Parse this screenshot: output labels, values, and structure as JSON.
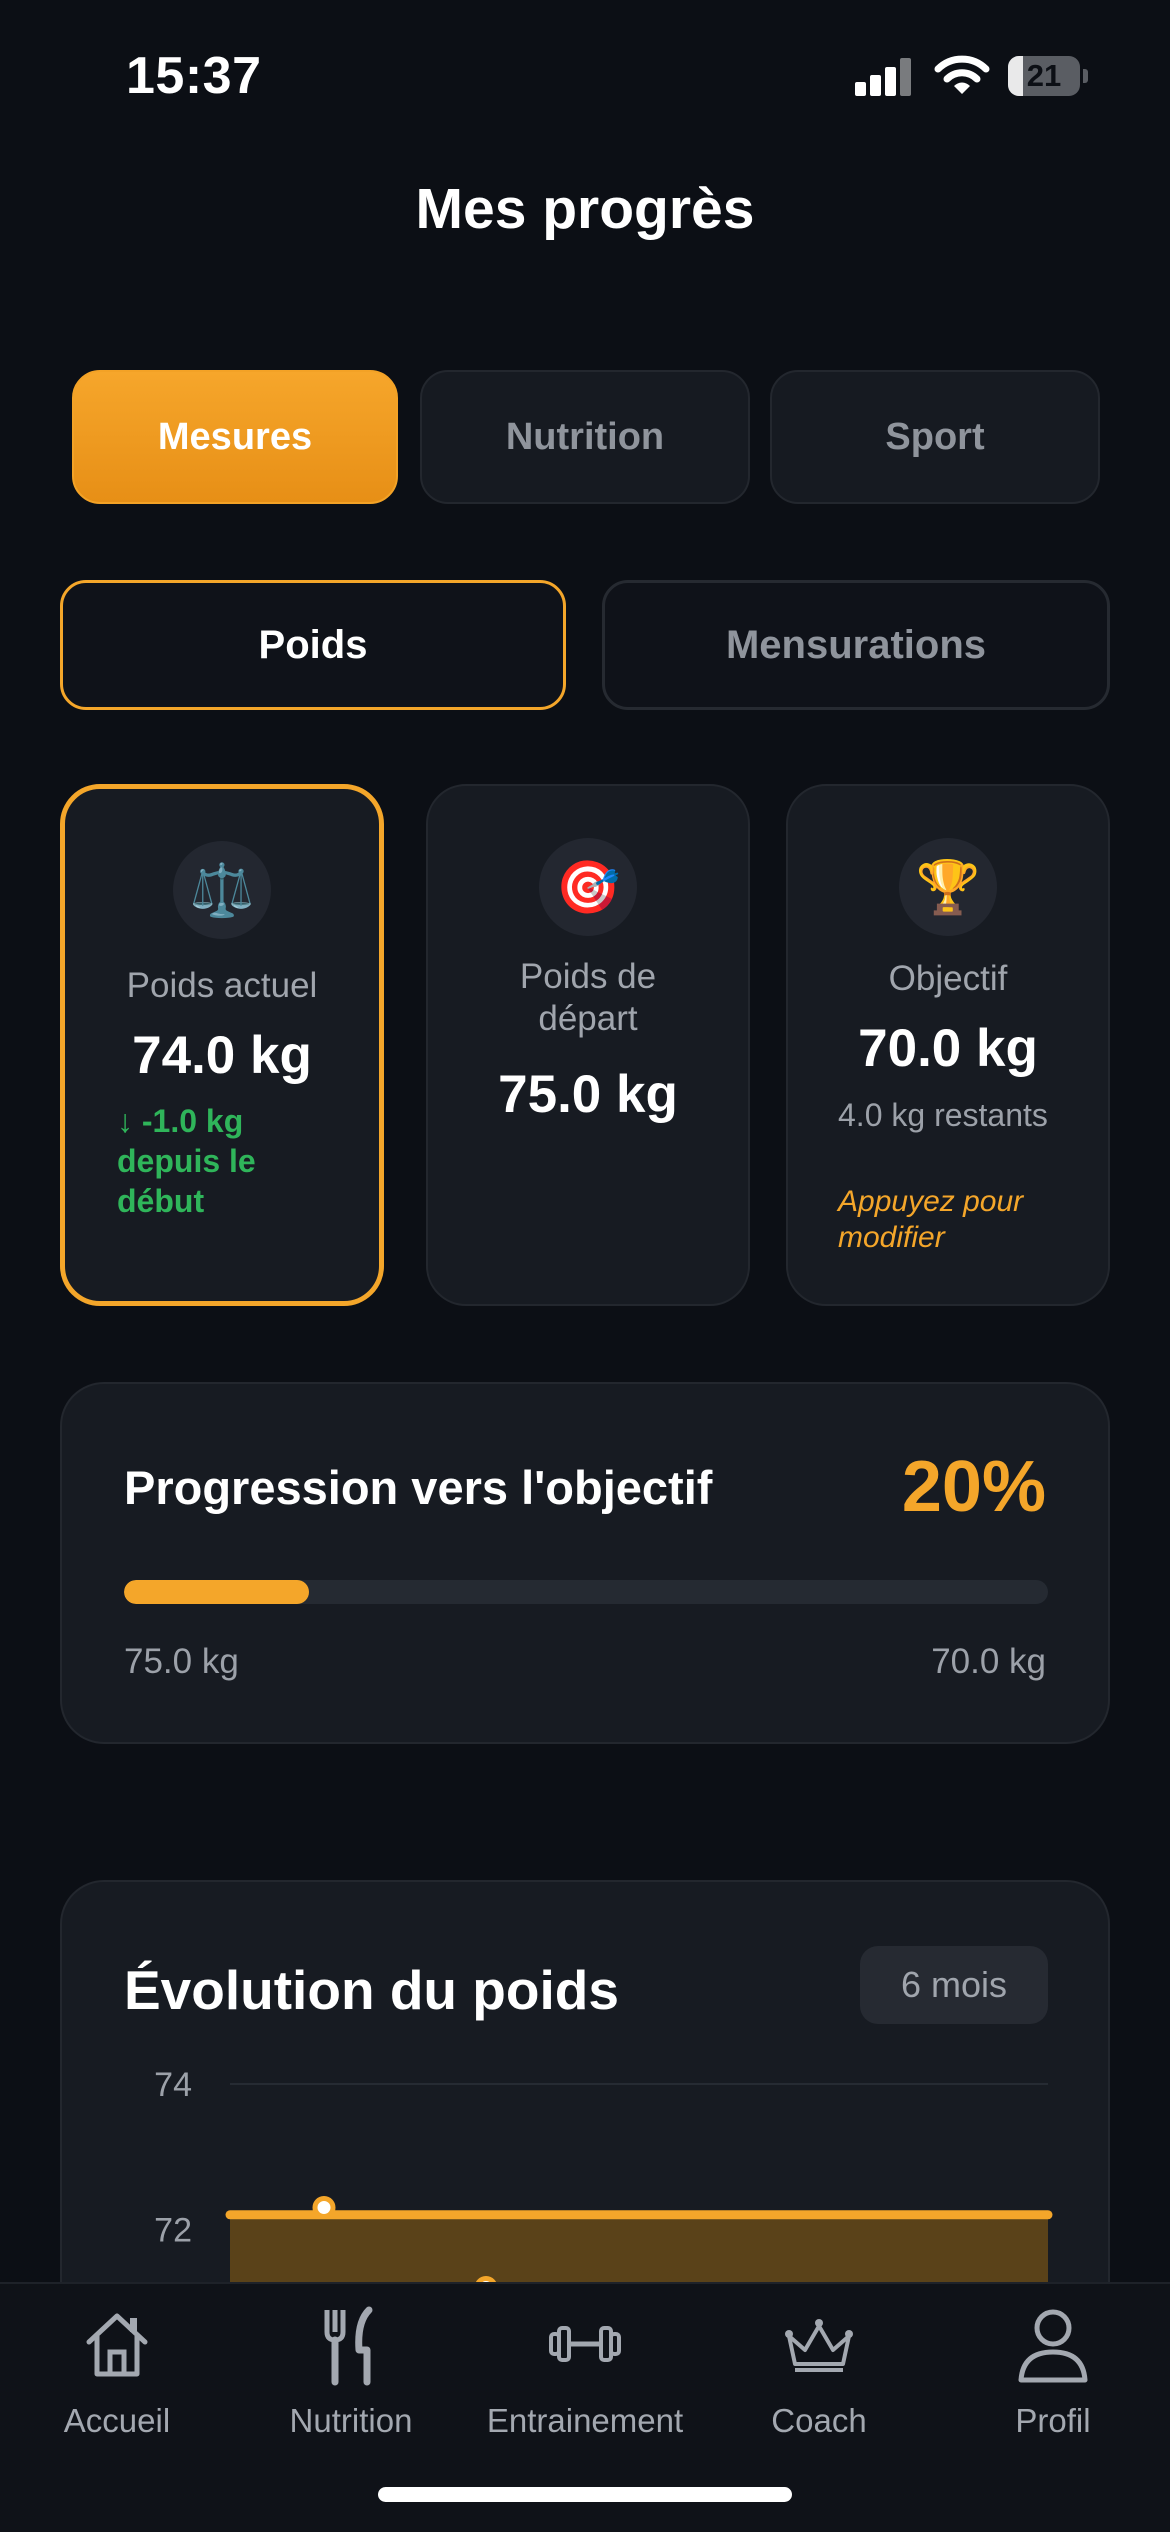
{
  "status": {
    "time": "15:37",
    "battery": "21",
    "battery_level": 0.21
  },
  "header": {
    "title": "Mes progrès"
  },
  "tabs": [
    {
      "label": "Mesures",
      "active": true
    },
    {
      "label": "Nutrition",
      "active": false
    },
    {
      "label": "Sport",
      "active": false
    }
  ],
  "subtabs": [
    {
      "label": "Poids",
      "active": true
    },
    {
      "label": "Mensurations",
      "active": false
    }
  ],
  "cards": {
    "current": {
      "icon": "scale-icon",
      "label": "Poids actuel",
      "value": "74.0 kg",
      "delta": "↓ -1.0 kg depuis le début"
    },
    "start": {
      "icon": "target-icon",
      "label": "Poids de départ",
      "value": "75.0 kg"
    },
    "goal": {
      "icon": "trophy-icon",
      "label": "Objectif",
      "value": "70.0 kg",
      "remaining": "4.0 kg restants",
      "hint": "Appuyez pour modifier"
    }
  },
  "progress": {
    "title": "Progression vers l'objectif",
    "percent_label": "20%",
    "percent": 20,
    "start_label": "75.0 kg",
    "end_label": "70.0 kg"
  },
  "chart": {
    "title": "Évolution du poids",
    "period": "6 mois"
  },
  "chart_data": {
    "type": "area",
    "title": "Évolution du poids",
    "y_ticks": [
      "74",
      "72"
    ],
    "ylim_visible": [
      71,
      74
    ],
    "series": [
      {
        "values": [
          72.2,
          72.2
        ]
      }
    ],
    "points": [
      {
        "y": 72.3
      },
      {
        "y": 71.2
      }
    ]
  },
  "nav": [
    {
      "label": "Accueil",
      "icon": "home-icon"
    },
    {
      "label": "Nutrition",
      "icon": "fork-knife-icon"
    },
    {
      "label": "Entrainement",
      "icon": "dumbbell-icon"
    },
    {
      "label": "Coach",
      "icon": "crown-icon"
    },
    {
      "label": "Profil",
      "icon": "user-icon"
    }
  ],
  "colors": {
    "accent": "#f4a62a",
    "success": "#2fb55a",
    "background": "#0c0f15",
    "card": "#171b22"
  }
}
